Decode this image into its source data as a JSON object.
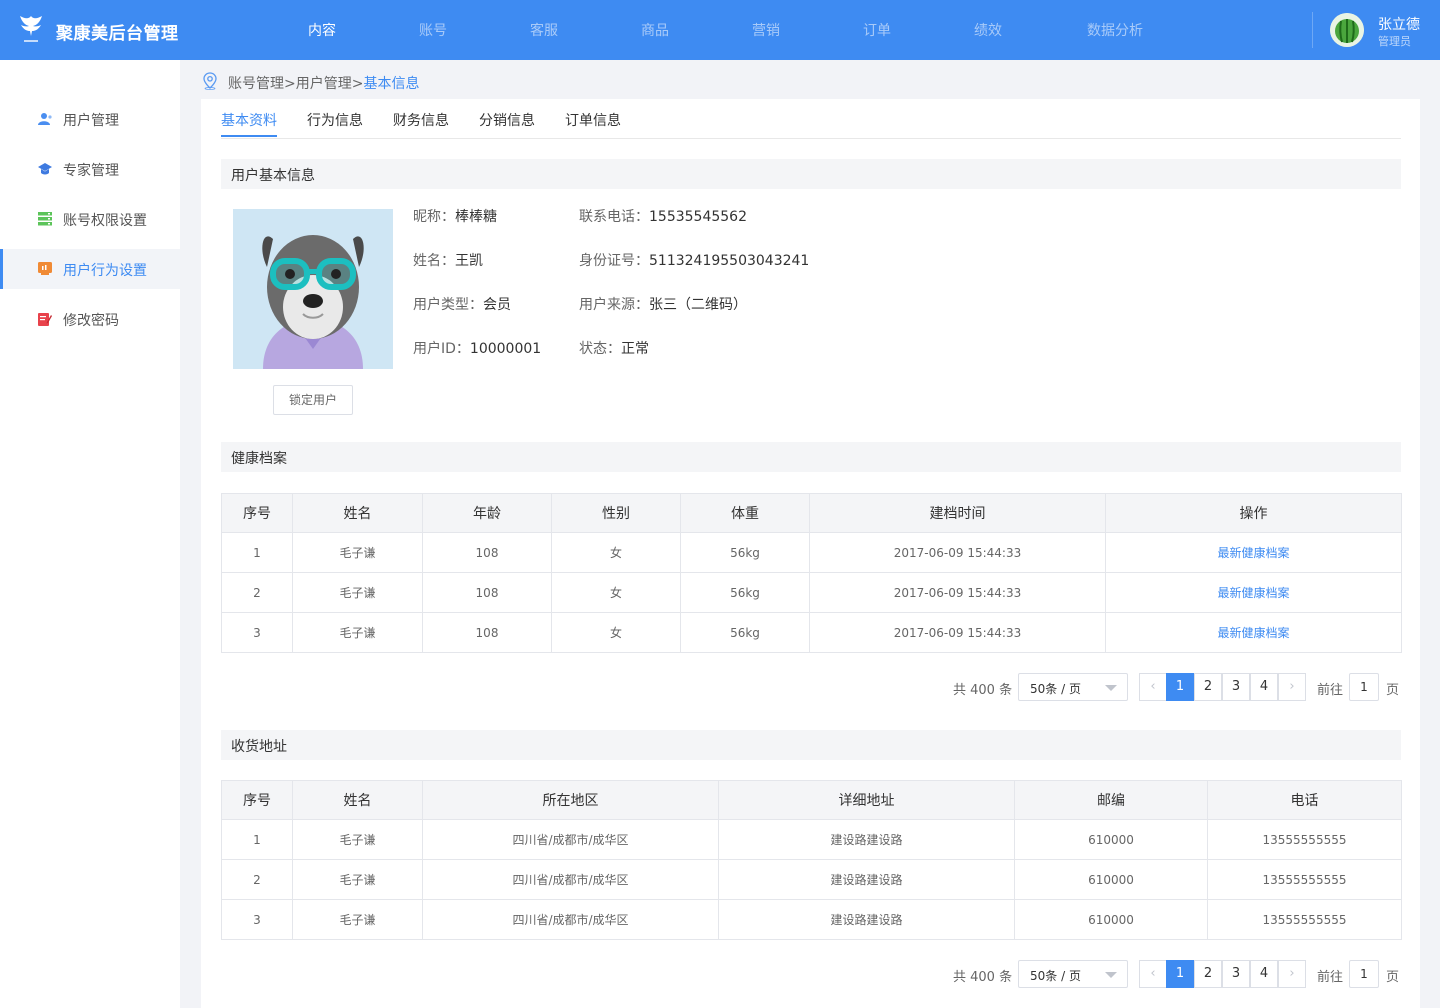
{
  "app": {
    "title": "聚康美后台管理"
  },
  "nav": [
    "内容",
    "账号",
    "客服",
    "商品",
    "营销",
    "订单",
    "绩效",
    "数据分析"
  ],
  "user": {
    "name": "张立德",
    "role": "管理员"
  },
  "sidebar": [
    {
      "label": "用户管理",
      "icon": "user-icon"
    },
    {
      "label": "专家管理",
      "icon": "graduation-cap-icon"
    },
    {
      "label": "账号权限设置",
      "icon": "stack-icon"
    },
    {
      "label": "用户行为设置",
      "icon": "chart-board-icon",
      "active": true
    },
    {
      "label": "修改密码",
      "icon": "edit-icon"
    }
  ],
  "breadcrumb": {
    "path": "账号管理>用户管理>",
    "current": "基本信息"
  },
  "tabs": [
    "基本资料",
    "行为信息",
    "财务信息",
    "分销信息",
    "订单信息"
  ],
  "profile": {
    "section_title": "用户基本信息",
    "lock_label": "锁定用户",
    "fields": [
      {
        "k": "昵称：",
        "v": "棒棒糖"
      },
      {
        "k": "联系电话：",
        "v": "15535545562"
      },
      {
        "k": "姓名：",
        "v": "王凯"
      },
      {
        "k": "身份证号：",
        "v": "511324195503043241"
      },
      {
        "k": "用户类型：",
        "v": "会员"
      },
      {
        "k": "用户来源：",
        "v": "张三（二维码）"
      },
      {
        "k": "用户ID：",
        "v": "10000001"
      },
      {
        "k": "状态：",
        "v": "正常"
      }
    ]
  },
  "health": {
    "section_title": "健康档案",
    "columns": [
      "序号",
      "姓名",
      "年龄",
      "性别",
      "体重",
      "建档时间",
      "操作"
    ],
    "rows": [
      [
        "1",
        "毛子谦",
        "108",
        "女",
        "56kg",
        "2017-06-09 15:44:33",
        "最新健康档案"
      ],
      [
        "2",
        "毛子谦",
        "108",
        "女",
        "56kg",
        "2017-06-09 15:44:33",
        "最新健康档案"
      ],
      [
        "3",
        "毛子谦",
        "108",
        "女",
        "56kg",
        "2017-06-09 15:44:33",
        "最新健康档案"
      ]
    ]
  },
  "address": {
    "section_title": "收货地址",
    "columns": [
      "序号",
      "姓名",
      "所在地区",
      "详细地址",
      "邮编",
      "电话"
    ],
    "rows": [
      [
        "1",
        "毛子谦",
        "四川省/成都市/成华区",
        "建设路建设路",
        "610000",
        "13555555555"
      ],
      [
        "2",
        "毛子谦",
        "四川省/成都市/成华区",
        "建设路建设路",
        "610000",
        "13555555555"
      ],
      [
        "3",
        "毛子谦",
        "四川省/成都市/成华区",
        "建设路建设路",
        "610000",
        "13555555555"
      ]
    ]
  },
  "pagination": {
    "total": "共 400 条",
    "page_size": "50条 / 页",
    "pages": [
      "1",
      "2",
      "3",
      "4"
    ],
    "goto_label": "前往",
    "goto_value": "1",
    "page_unit": "页"
  },
  "colors": {
    "primary": "#3e8bf2",
    "header": "#3e8bf2"
  }
}
